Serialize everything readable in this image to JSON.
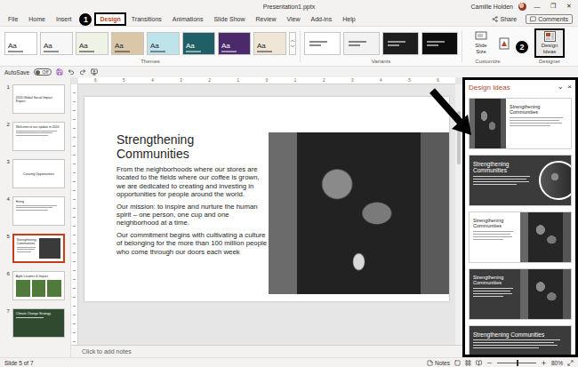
{
  "window": {
    "title": "Presentation1.pptx",
    "user": "Camille Holden",
    "controls": [
      "—",
      "❐",
      "✕"
    ]
  },
  "ribbon": {
    "tabs": [
      {
        "label": "File",
        "selected": false
      },
      {
        "label": "Home",
        "selected": false
      },
      {
        "label": "Insert",
        "selected": false
      },
      {
        "label": "Design",
        "selected": true
      },
      {
        "label": "Transitions",
        "selected": false
      },
      {
        "label": "Animations",
        "selected": false
      },
      {
        "label": "Slide Show",
        "selected": false
      },
      {
        "label": "Review",
        "selected": false
      },
      {
        "label": "View",
        "selected": false
      },
      {
        "label": "Add-ins",
        "selected": false
      },
      {
        "label": "Help",
        "selected": false
      }
    ],
    "actions": [
      "Share",
      "Comments"
    ],
    "themes": {
      "label": "Themes",
      "items": [
        {
          "sample": "Aa",
          "color": "#ffffff"
        },
        {
          "sample": "Aa",
          "color": "#f7f7f7"
        },
        {
          "sample": "Aa",
          "color": "#eef3e6"
        },
        {
          "sample": "Aa",
          "color": "#d9c7a8"
        },
        {
          "sample": "Aa",
          "color": "#bfe3ea"
        },
        {
          "sample": "Aa",
          "color": "#1f5f66"
        },
        {
          "sample": "Aa",
          "color": "#4b2a6b"
        },
        {
          "sample": "Aa",
          "color": "#efe6d6"
        }
      ]
    },
    "variants": {
      "label": "Variants",
      "items": [
        {
          "color": "#ffffff"
        },
        {
          "color": "#f2f2f2"
        },
        {
          "color": "#1e1e1e"
        },
        {
          "color": "#0d0d0d"
        }
      ]
    },
    "customize": {
      "label": "Customize",
      "button": "Slide Size"
    },
    "designer": {
      "label": "Designer",
      "button": "Design Ideas"
    }
  },
  "callouts": [
    "1",
    "2"
  ],
  "quick_access": {
    "label": "AutoSave",
    "toggle": "Off",
    "on": false
  },
  "ruler_marks": [
    "6",
    "5",
    "4",
    "3",
    "2",
    "1",
    "0",
    "1",
    "2",
    "3",
    "4",
    "5",
    "6"
  ],
  "slides": [
    {
      "number": "1",
      "title": "2020 Global Social Impact Report",
      "kind": "title",
      "selected": false
    },
    {
      "number": "2",
      "title": "Welcome to our update in 2020",
      "kind": "text",
      "selected": false
    },
    {
      "number": "3",
      "title": "Creating Opportunities",
      "kind": "title",
      "selected": false
    },
    {
      "number": "4",
      "title": "Hiring",
      "kind": "text",
      "selected": false
    },
    {
      "number": "5",
      "title": "Strengthening Communities",
      "kind": "photo-right",
      "selected": true
    },
    {
      "number": "6",
      "title": "Agile Leaders & Impact",
      "kind": "photo-grid",
      "selected": false
    },
    {
      "number": "7",
      "title": "Climate Change Strategy",
      "kind": "photo-dark",
      "selected": false
    }
  ],
  "slide": {
    "title": "Strengthening Communities",
    "paragraphs": [
      "From the neighborhoods where our stores are located to the fields where our coffee is grown, we are dedicated to creating and investing in opportunities for people around the world.",
      "Our mission: to inspire and nurture the human spirit – one person, one cup and one neighborhood at a time.",
      "Our commitment begins with cultivating a culture of belonging for the more than 100 million people who come through our doors each week"
    ]
  },
  "notes": {
    "placeholder": "Click to add notes"
  },
  "design_ideas": {
    "title": "Design Ideas",
    "controls": [
      "⌄",
      "×"
    ],
    "items": [
      {
        "kind": "photo-left",
        "title": "Strengthening Communities"
      },
      {
        "kind": "dark-circle",
        "title": "Strengthening Communities"
      },
      {
        "kind": "photo-right",
        "title": "Strengthening Communities"
      },
      {
        "kind": "dark-photo-right",
        "title": "Strengthening Communities"
      },
      {
        "kind": "dark",
        "title": "Strengthening Communities"
      }
    ]
  },
  "status_bar": {
    "position": "Slide 5 of 7",
    "notes": "Notes",
    "zoom": "80%",
    "zoom_level": 0.5
  }
}
